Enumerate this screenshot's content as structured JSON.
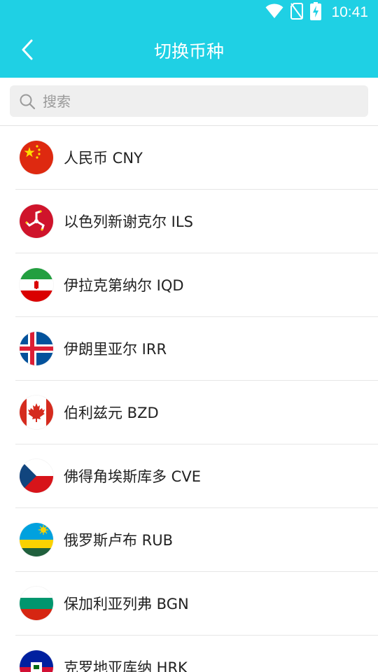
{
  "status_bar": {
    "time": "10:41",
    "icons": [
      "wifi-icon",
      "no-sim-icon",
      "battery-charging-icon"
    ]
  },
  "header": {
    "title": "切换币种",
    "back_icon": "chevron-left-icon"
  },
  "search": {
    "placeholder": "搜索",
    "value": ""
  },
  "colors": {
    "primary": "#1fd0e4",
    "background": "#ffffff",
    "search_bg": "#efefef",
    "divider": "#e6e6e6"
  },
  "currencies": [
    {
      "label": "人民币 CNY",
      "flag": "china-flag"
    },
    {
      "label": "以色列新谢克尔 ILS",
      "flag": "isle-of-man-flag"
    },
    {
      "label": "伊拉克第纳尔 IQD",
      "flag": "iran-flag"
    },
    {
      "label": "伊朗里亚尔 IRR",
      "flag": "iceland-flag"
    },
    {
      "label": "伯利兹元 BZD",
      "flag": "canada-flag"
    },
    {
      "label": "佛得角埃斯库多 CVE",
      "flag": "czech-flag"
    },
    {
      "label": "俄罗斯卢布 RUB",
      "flag": "rwanda-flag"
    },
    {
      "label": "保加利亚列弗 BGN",
      "flag": "bulgaria-flag"
    },
    {
      "label": "克罗地亚库纳 HRK",
      "flag": "haiti-flag"
    }
  ]
}
